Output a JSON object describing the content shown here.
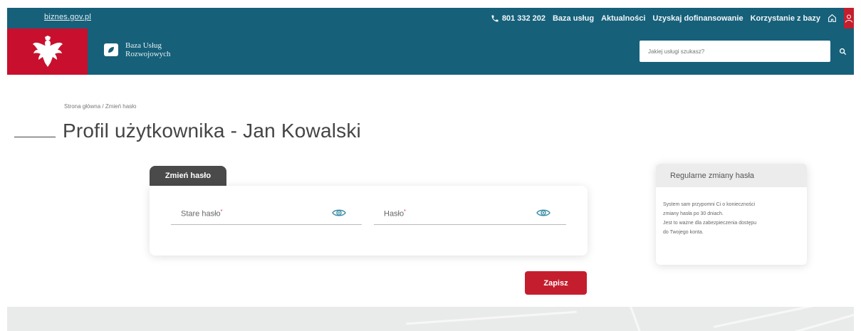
{
  "topbar": {
    "site_link": "biznes.gov.pl",
    "phone": "801 332 202",
    "links": [
      "Baza usług",
      "Aktualności",
      "Uzyskaj dofinansowanie",
      "Korzystanie z bazy"
    ]
  },
  "header": {
    "brand_line1": "Baza Usług",
    "brand_line2": "Rozwojowych",
    "search_placeholder": "Jakiej usługi szukasz?"
  },
  "breadcrumb": "Strona główna / Zmień hasło",
  "page_title": "Profil użytkownika - Jan Kowalski",
  "form": {
    "tab_label": "Zmień hasło",
    "old_password_label": "Stare hasło",
    "new_password_label": "Hasło",
    "required_mark": "*",
    "save_label": "Zapisz"
  },
  "info": {
    "title": "Regularne zmiany hasła",
    "line1": "System sam przypomni Ci o konieczności",
    "line2": "zmiany hasła po 30 dniach.",
    "line3": "Jest to ważne dla zabezpieczenia dostępu",
    "line4": "do Twojego konta."
  },
  "colors": {
    "primary": "#16607a",
    "accent": "#c41e2e",
    "emblem_bg": "#c8102e",
    "tab_bg": "#4a4a4a"
  },
  "icons": [
    "phone-icon",
    "home-icon",
    "user-icon",
    "emblem-eagle-icon",
    "brand-leaf-icon",
    "search-icon",
    "eye-icon"
  ]
}
